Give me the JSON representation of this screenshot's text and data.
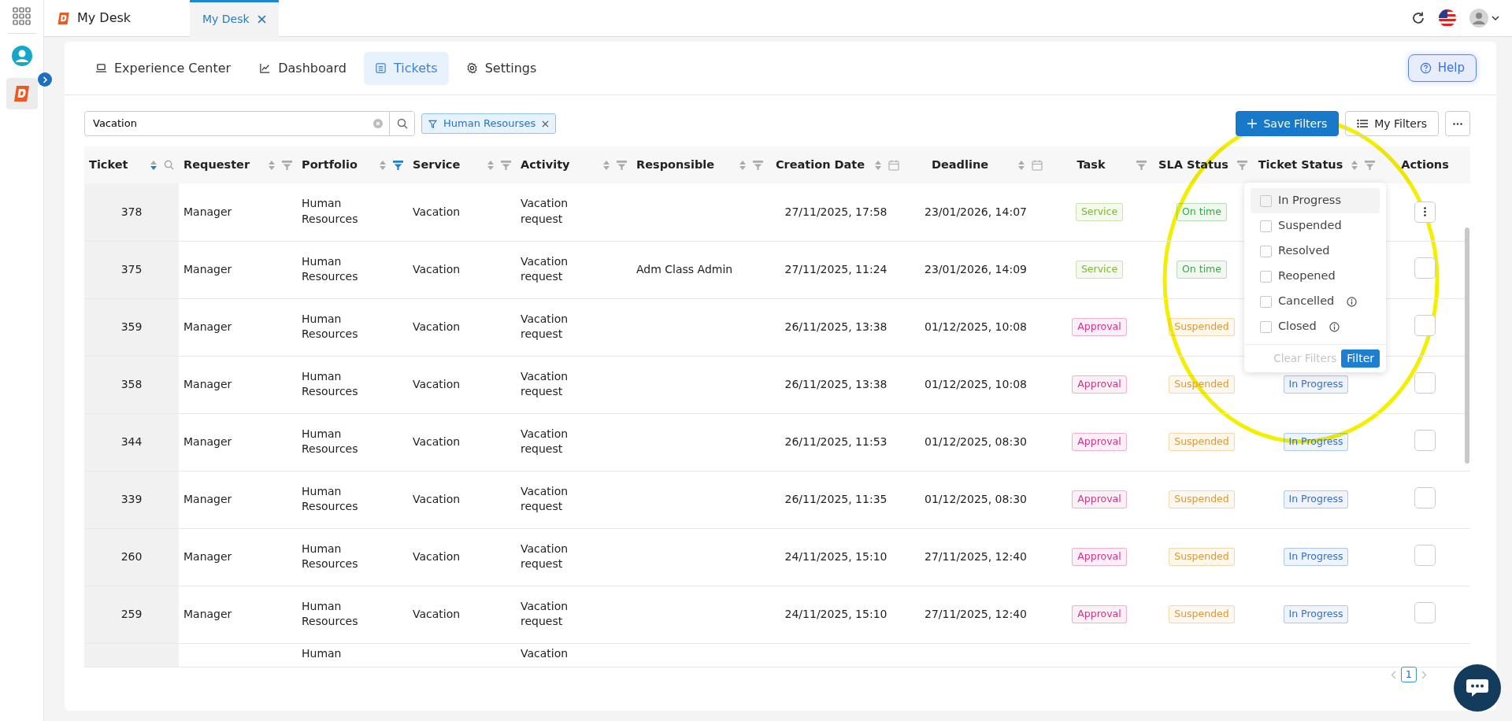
{
  "app": {
    "title": "My Desk"
  },
  "tabs": [
    {
      "label": "My Desk",
      "selected": true
    }
  ],
  "nav": [
    {
      "label": "Experience Center",
      "selected": false
    },
    {
      "label": "Dashboard",
      "selected": false
    },
    {
      "label": "Tickets",
      "selected": true
    },
    {
      "label": "Settings",
      "selected": false
    }
  ],
  "help": {
    "label": "Help"
  },
  "search": {
    "value": "Vacation"
  },
  "filter_chips": [
    {
      "label": "Human Resourses"
    }
  ],
  "toolbar": {
    "save": "Save Filters",
    "my_filters": "My Filters"
  },
  "columns": [
    {
      "label": "Ticket",
      "kind": "search",
      "sorted": true
    },
    {
      "label": "Requester",
      "kind": "filter",
      "sorted": false,
      "active": false
    },
    {
      "label": "Portfolio",
      "kind": "filter",
      "sorted": false,
      "active": true
    },
    {
      "label": "Service",
      "kind": "filter",
      "sorted": false,
      "active": false
    },
    {
      "label": "Activity",
      "kind": "filter",
      "sorted": false,
      "active": false
    },
    {
      "label": "Responsible",
      "kind": "filter",
      "sorted": false,
      "active": false
    },
    {
      "label": "Creation Date",
      "kind": "date",
      "sorted": false
    },
    {
      "label": "Deadline",
      "kind": "date",
      "sorted": false
    },
    {
      "label": "Task",
      "kind": "filter",
      "active": false
    },
    {
      "label": "SLA Status",
      "kind": "filter",
      "active": false
    },
    {
      "label": "Ticket Status",
      "kind": "filter",
      "sorted": false,
      "active": false
    },
    {
      "label": "Actions",
      "kind": "plain"
    }
  ],
  "rows": [
    {
      "ticket": "378",
      "requester": "Manager",
      "portfolio": "Human Resources",
      "service": "Vacation",
      "activity": "Vacation request",
      "created": "27/11/2025, 17:58",
      "deadline": "23/01/2026, 14:07",
      "task": {
        "label": "Service",
        "color": "#7cb82f"
      },
      "sla": {
        "label": "On time",
        "color": "#3aa845"
      },
      "menu_shown": true
    },
    {
      "ticket": "375",
      "requester": "Manager",
      "portfolio": "Human Resources",
      "service": "Vacation",
      "activity": "Vacation request",
      "responsible": "Adm Class Admin",
      "created": "27/11/2025, 11:24",
      "deadline": "23/01/2026, 14:09",
      "task": {
        "label": "Service",
        "color": "#7cb82f"
      },
      "sla": {
        "label": "On time",
        "color": "#3aa845"
      },
      "menu_shown": false
    },
    {
      "ticket": "359",
      "requester": "Manager",
      "portfolio": "Human Resources",
      "service": "Vacation",
      "activity": "Vacation request",
      "created": "26/11/2025, 13:38",
      "deadline": "01/12/2025, 10:08",
      "task": {
        "label": "Approval",
        "color": "#d6338a"
      },
      "sla": {
        "label": "Suspended",
        "color": "#e09a2a"
      },
      "menu_shown": false
    },
    {
      "ticket": "358",
      "requester": "Manager",
      "portfolio": "Human Resources",
      "service": "Vacation",
      "activity": "Vacation request",
      "created": "26/11/2025, 13:38",
      "deadline": "01/12/2025, 10:08",
      "task": {
        "label": "Approval",
        "color": "#d6338a"
      },
      "sla": {
        "label": "Suspended",
        "color": "#e09a2a"
      },
      "status": {
        "label": "In Progress",
        "color": "#2f6fd6"
      },
      "menu_shown": false
    },
    {
      "ticket": "344",
      "requester": "Manager",
      "portfolio": "Human Resources",
      "service": "Vacation",
      "activity": "Vacation request",
      "created": "26/11/2025, 11:53",
      "deadline": "01/12/2025, 08:30",
      "task": {
        "label": "Approval",
        "color": "#d6338a"
      },
      "sla": {
        "label": "Suspended",
        "color": "#e09a2a"
      },
      "status": {
        "label": "In Progress",
        "color": "#2f6fd6"
      },
      "menu_shown": false
    },
    {
      "ticket": "339",
      "requester": "Manager",
      "portfolio": "Human Resources",
      "service": "Vacation",
      "activity": "Vacation request",
      "created": "26/11/2025, 11:35",
      "deadline": "01/12/2025, 08:30",
      "task": {
        "label": "Approval",
        "color": "#d6338a"
      },
      "sla": {
        "label": "Suspended",
        "color": "#e09a2a"
      },
      "status": {
        "label": "In Progress",
        "color": "#2f6fd6"
      },
      "menu_shown": false
    },
    {
      "ticket": "260",
      "requester": "Manager",
      "portfolio": "Human Resources",
      "service": "Vacation",
      "activity": "Vacation request",
      "created": "24/11/2025, 15:10",
      "deadline": "27/11/2025, 12:40",
      "task": {
        "label": "Approval",
        "color": "#d6338a"
      },
      "sla": {
        "label": "Suspended",
        "color": "#e09a2a"
      },
      "status": {
        "label": "In Progress",
        "color": "#2f6fd6"
      },
      "menu_shown": false
    },
    {
      "ticket": "259",
      "requester": "Manager",
      "portfolio": "Human Resources",
      "service": "Vacation",
      "activity": "Vacation request",
      "created": "24/11/2025, 15:10",
      "deadline": "27/11/2025, 12:40",
      "task": {
        "label": "Approval",
        "color": "#d6338a"
      },
      "sla": {
        "label": "Suspended",
        "color": "#e09a2a"
      },
      "status": {
        "label": "In Progress",
        "color": "#2f6fd6"
      },
      "menu_shown": false
    },
    {
      "portfolio": "Human",
      "activity": "Vacation"
    }
  ],
  "dropdown": {
    "options": [
      {
        "label": "In Progress",
        "checked": false,
        "hovered": true,
        "info": false
      },
      {
        "label": "Suspended",
        "checked": false,
        "hovered": false,
        "info": false
      },
      {
        "label": "Resolved",
        "checked": false,
        "hovered": false,
        "info": false
      },
      {
        "label": "Reopened",
        "checked": false,
        "hovered": false,
        "info": false
      },
      {
        "label": "Cancelled",
        "checked": false,
        "hovered": false,
        "info": true
      },
      {
        "label": "Closed",
        "checked": false,
        "hovered": false,
        "info": true
      }
    ],
    "clear": "Clear Filters",
    "apply": "Filter"
  },
  "pagination": {
    "pages": [
      {
        "label": "1",
        "selected": true
      }
    ]
  }
}
